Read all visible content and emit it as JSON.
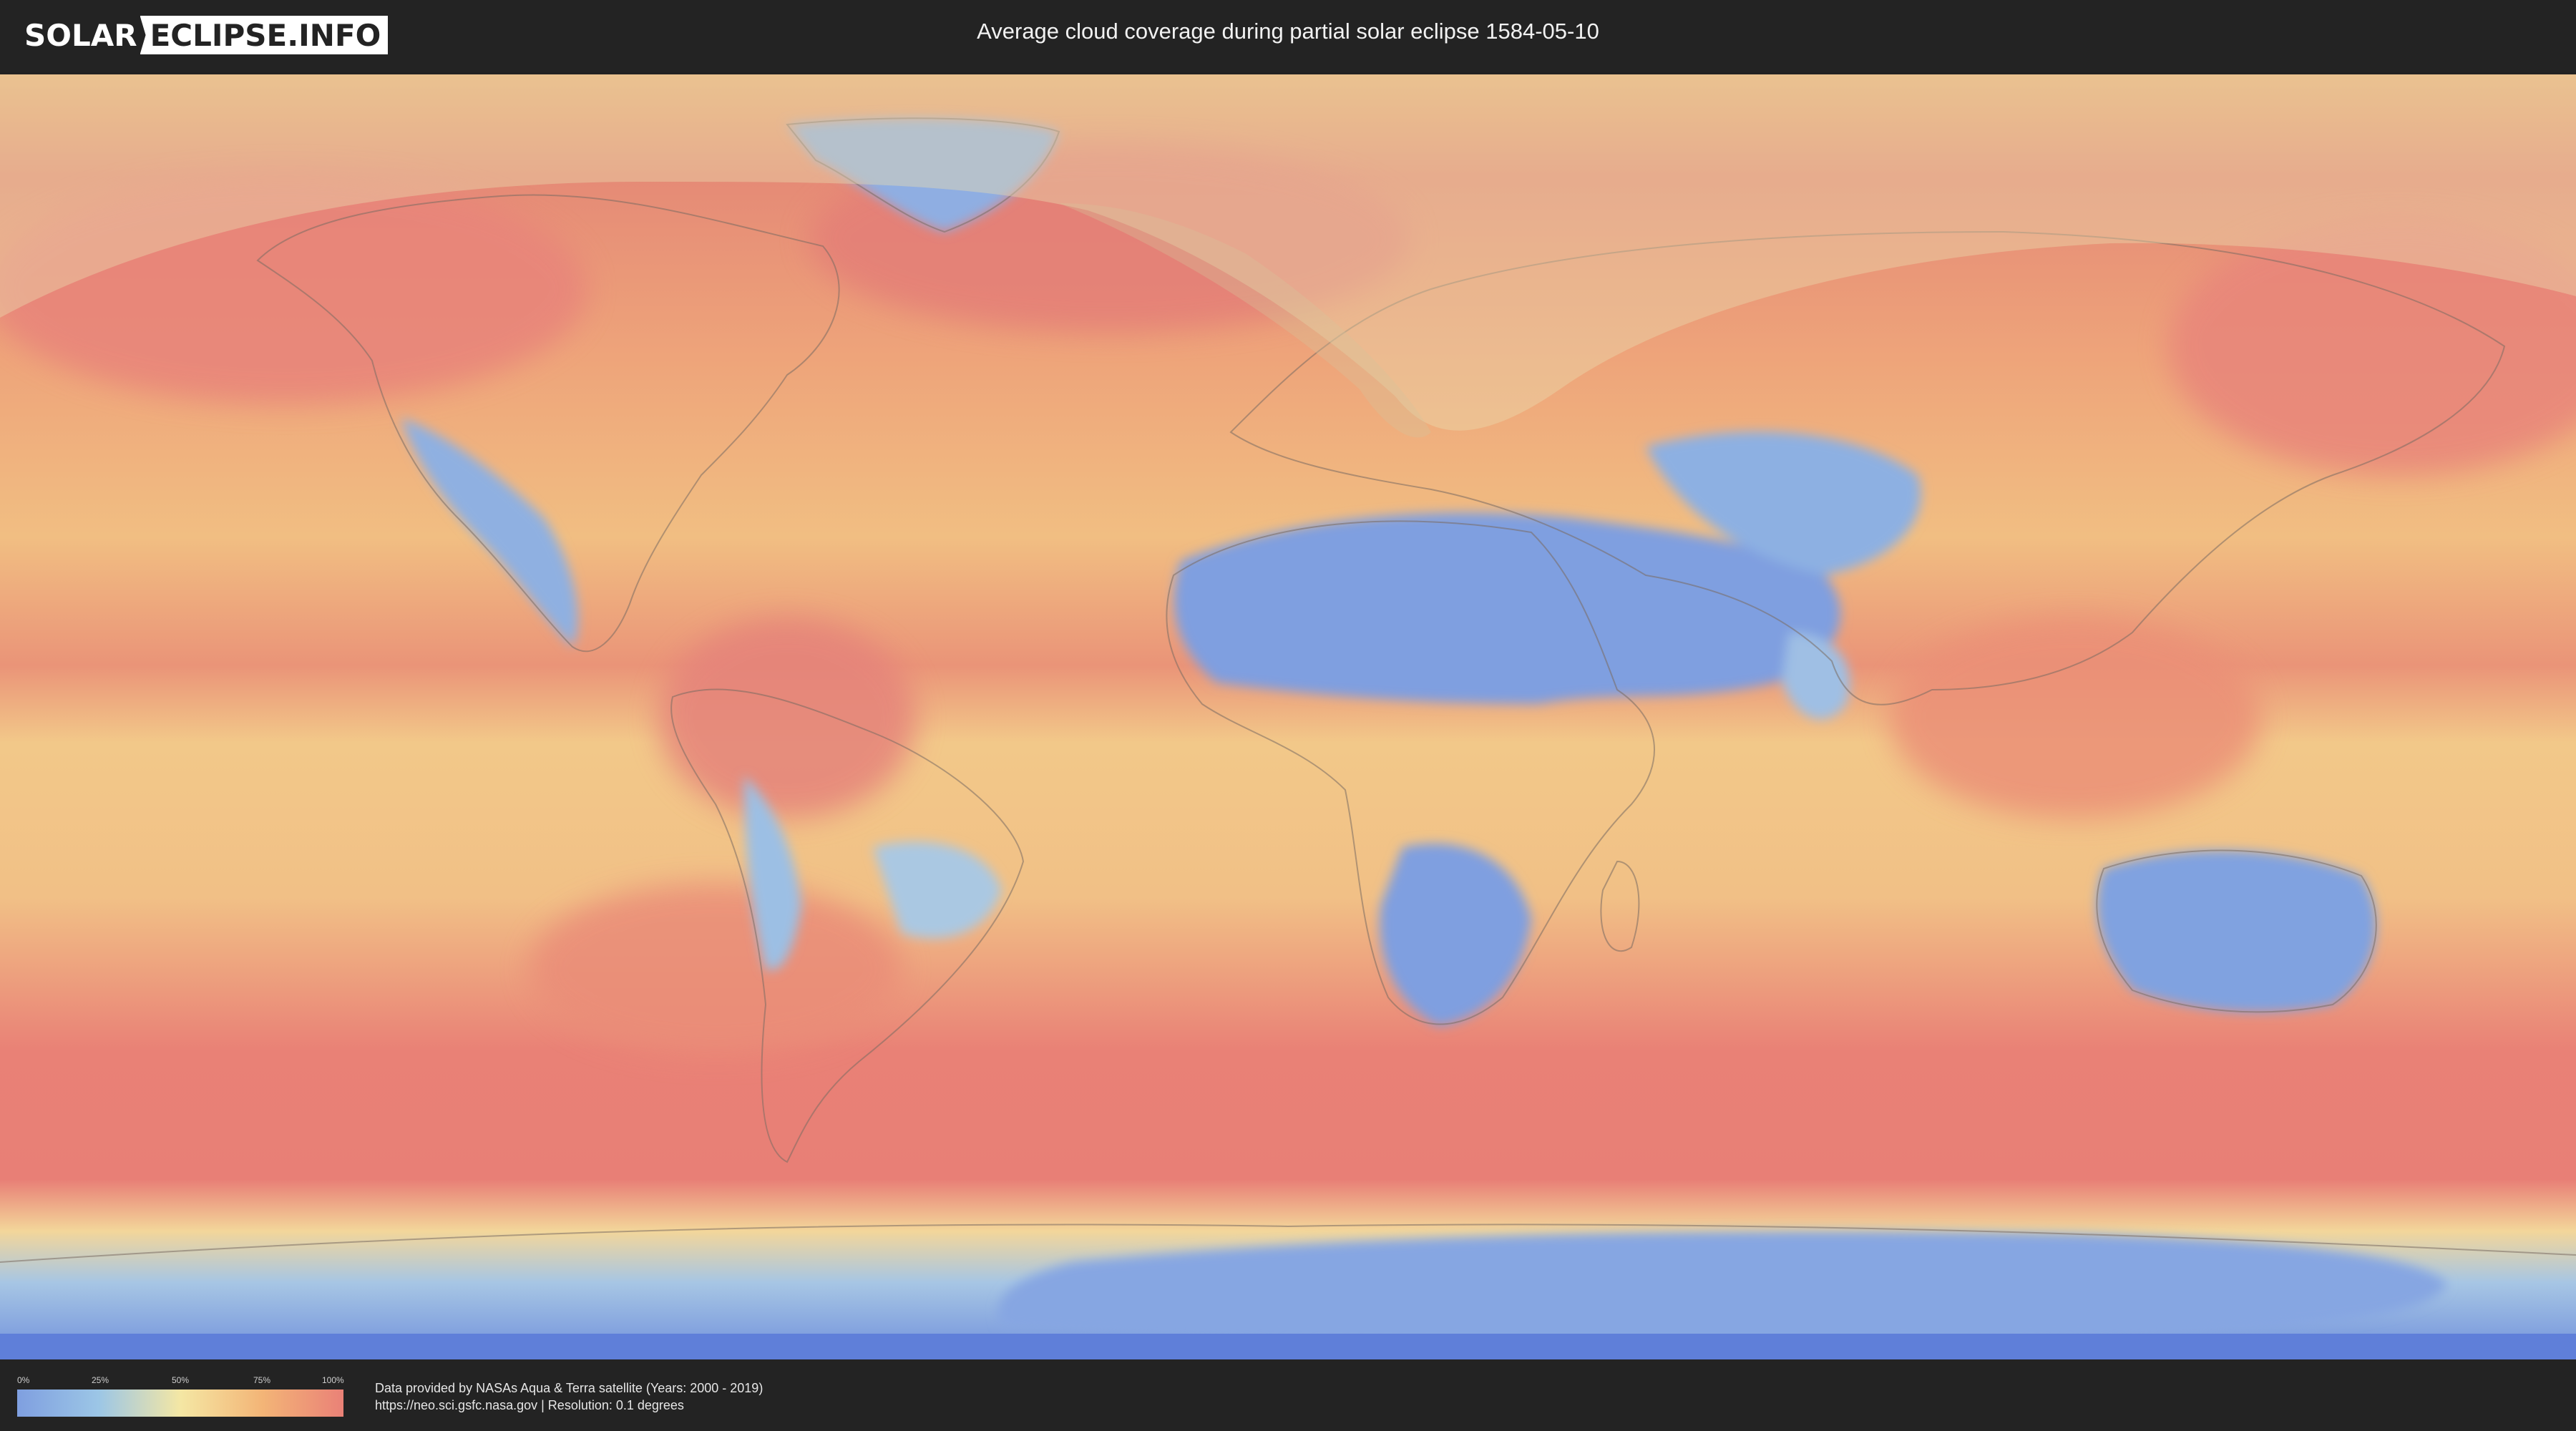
{
  "header": {
    "logo_left": "SOLAR",
    "logo_right": "ECLIPSE.INFO",
    "title": "Average cloud coverage during partial solar eclipse 1584-05-10"
  },
  "map": {
    "colors": {
      "clear": "#7f9fe0",
      "low": "#9cc6e6",
      "mid": "#f4e7a4",
      "high": "#f3b577",
      "overcast": "#ea8177",
      "eclipse_overlay": "#e9dcae"
    },
    "icons": [
      "world-map-icon",
      "eclipse-visibility-zone"
    ]
  },
  "legend": {
    "ticks": [
      "0%",
      "25%",
      "50%",
      "75%",
      "100%"
    ]
  },
  "footer": {
    "line1": "Data provided by NASAs Aqua & Terra satellite (Years: 2000 - 2019)",
    "line2": "https://neo.sci.gsfc.nasa.gov | Resolution: 0.1 degrees"
  }
}
